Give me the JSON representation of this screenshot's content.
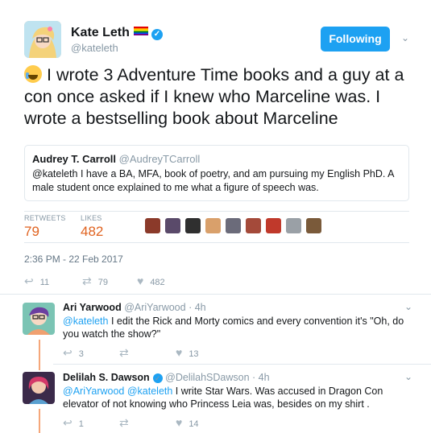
{
  "author": {
    "name": "Kate Leth",
    "handle": "@kateleth",
    "follow_label": "Following"
  },
  "tweet": {
    "text": "I wrote 3 Adventure Time books and a guy at a con once asked if I knew who Marceline was. I wrote a bestselling book about Marceline"
  },
  "quote": {
    "name": "Audrey T. Carroll",
    "handle": "@AudreyTCarroll",
    "text": "@kateleth I have a BA, MFA, book of poetry, and am pursuing my English PhD. A male student once explained to me what a figure of speech was."
  },
  "stats": {
    "retweets_label": "RETWEETS",
    "retweets": "79",
    "likes_label": "LIKES",
    "likes": "482"
  },
  "timestamp": "2:36 PM - 22 Feb 2017",
  "actions": {
    "replies": "11",
    "retweets": "79",
    "likes": "482"
  },
  "replies": [
    {
      "name": "Ari Yarwood",
      "handle": "@AriYarwood",
      "time": "· 4h",
      "mention": "@kateleth",
      "text": " I edit the Rick and Morty comics and every convention it's \"Oh, do you watch the show?\"",
      "reply_count": "3",
      "retweet_count": "",
      "like_count": "13"
    },
    {
      "name": "Delilah S. Dawson",
      "handle": "@DelilahSDawson",
      "time": "· 4h",
      "mention": "@AriYarwood @kateleth",
      "text": " I write Star Wars. Was accused in Dragon Con elevator of not knowing who Princess Leia was, besides on my shirt .",
      "reply_count": "1",
      "retweet_count": "",
      "like_count": "14"
    }
  ],
  "colors": {
    "accent": "#1da1f2",
    "stat_orange": "#e0621f",
    "muted": "#8899a6",
    "thread_line": "#f5a77a"
  },
  "icons": {
    "reply": "reply-arrow",
    "retweet": "retweet-arrows",
    "like": "heart",
    "more": "chevron-down",
    "verified": "verified-badge"
  }
}
